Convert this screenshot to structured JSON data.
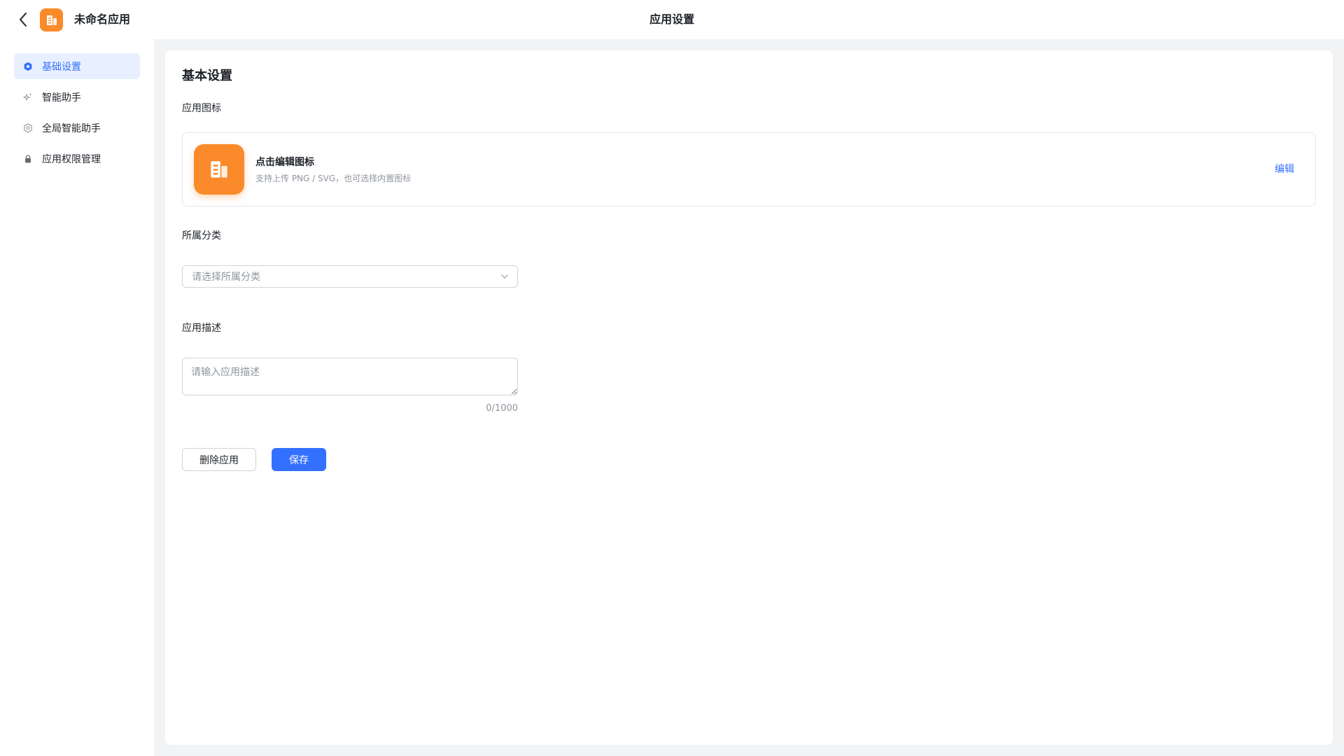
{
  "topbar": {
    "app_name": "未命名应用",
    "page_title": "应用设置",
    "back_icon": "chevron-left-icon",
    "logo_icon": "building-icon"
  },
  "sidebar": {
    "items": [
      {
        "label": "基础设置",
        "icon": "gear-icon",
        "active": true
      },
      {
        "label": "智能助手",
        "icon": "sparkle-icon",
        "active": false
      },
      {
        "label": "全局智能助手",
        "icon": "gear-outline-icon",
        "active": false
      },
      {
        "label": "应用权限管理",
        "icon": "lock-icon",
        "active": false
      }
    ]
  },
  "main": {
    "section_title": "基本设置",
    "app_icon": {
      "label": "应用图标",
      "title": "点击编辑图标",
      "hint": "支持上传 PNG / SVG，也可选择内置图标",
      "edit_label": "编辑",
      "icon": "building-icon"
    },
    "category": {
      "label": "所属分类",
      "placeholder": "请选择所属分类"
    },
    "description": {
      "label": "应用描述",
      "placeholder": "请输入应用描述",
      "counter": "0/1000"
    },
    "actions": {
      "delete_label": "删除应用",
      "save_label": "保存"
    }
  },
  "colors": {
    "accent": "#3370ff",
    "brand_orange": "#fa8a2a",
    "active_bg": "#e8efff",
    "content_bg": "#f2f3f5"
  }
}
